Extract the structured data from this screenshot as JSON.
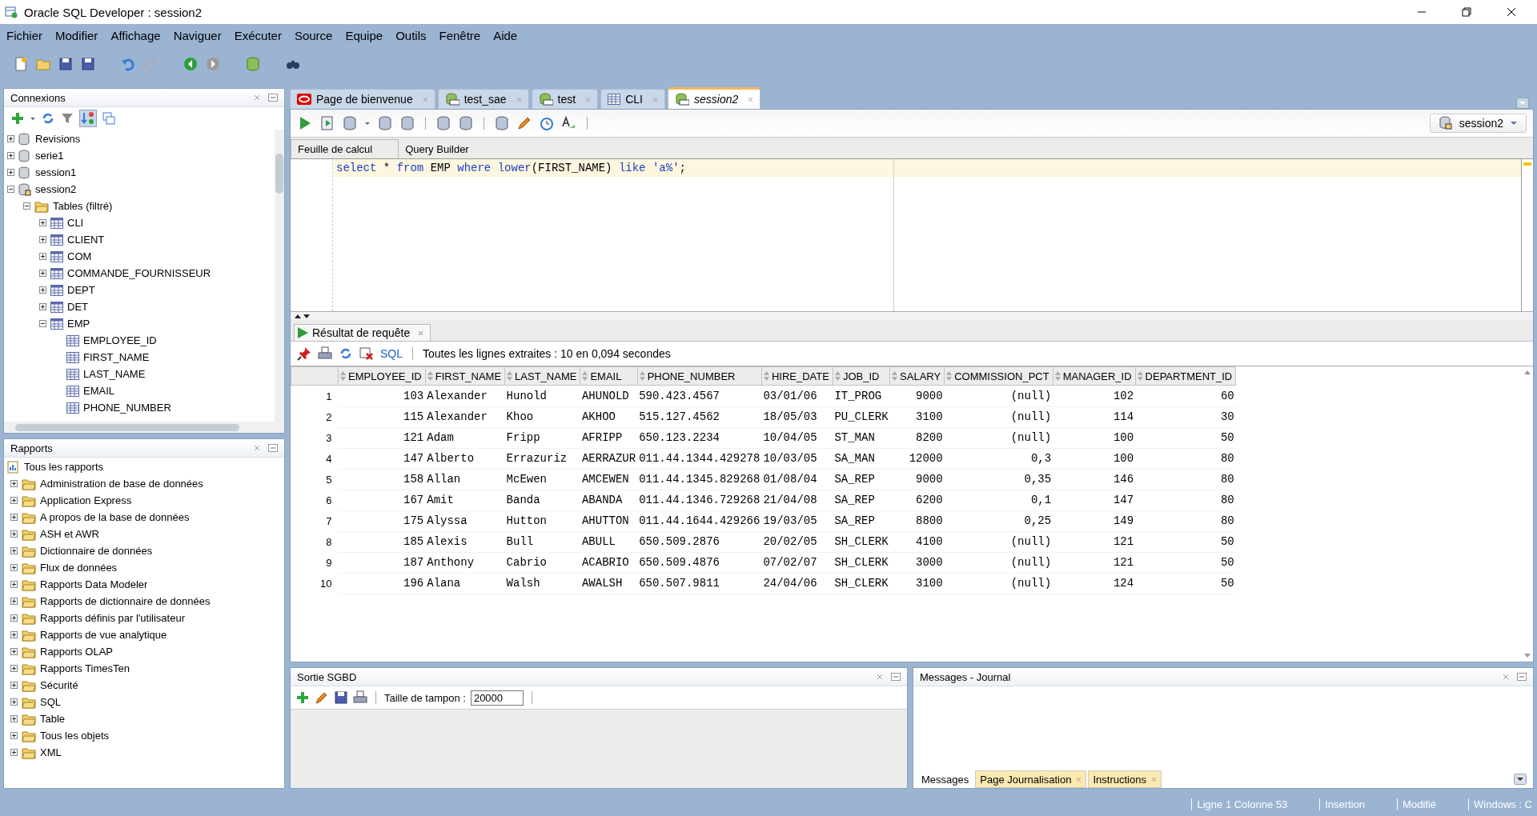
{
  "window": {
    "title": "Oracle SQL Developer : session2"
  },
  "menu": [
    "Fichier",
    "Modifier",
    "Affichage",
    "Naviguer",
    "Exécuter",
    "Source",
    "Equipe",
    "Outils",
    "Fenêtre",
    "Aide"
  ],
  "connections": {
    "title": "Connexions",
    "items": [
      {
        "label": "Revisions",
        "kind": "db",
        "expanded": false
      },
      {
        "label": "serie1",
        "kind": "db",
        "expanded": false
      },
      {
        "label": "session1",
        "kind": "db",
        "expanded": false
      },
      {
        "label": "session2",
        "kind": "dbopen",
        "expanded": true,
        "children": [
          {
            "label": "Tables (filtré)",
            "kind": "folder",
            "expanded": true,
            "children": [
              {
                "label": "CLI",
                "kind": "table",
                "expanded": false
              },
              {
                "label": "CLIENT",
                "kind": "table",
                "expanded": false
              },
              {
                "label": "COM",
                "kind": "table",
                "expanded": false
              },
              {
                "label": "COMMANDE_FOURNISSEUR",
                "kind": "table",
                "expanded": false
              },
              {
                "label": "DEPT",
                "kind": "table",
                "expanded": false
              },
              {
                "label": "DET",
                "kind": "table",
                "expanded": false
              },
              {
                "label": "EMP",
                "kind": "table",
                "expanded": true,
                "children": [
                  {
                    "label": "EMPLOYEE_ID",
                    "kind": "column"
                  },
                  {
                    "label": "FIRST_NAME",
                    "kind": "column"
                  },
                  {
                    "label": "LAST_NAME",
                    "kind": "column"
                  },
                  {
                    "label": "EMAIL",
                    "kind": "column"
                  },
                  {
                    "label": "PHONE_NUMBER",
                    "kind": "column"
                  }
                ]
              }
            ]
          }
        ]
      }
    ]
  },
  "reports": {
    "title": "Rapports",
    "items": [
      {
        "label": "Tous les rapports",
        "kind": "reports",
        "children": [
          {
            "label": "Administration de base de données",
            "kind": "folder",
            "expanded": false
          },
          {
            "label": "Application Express",
            "kind": "folder",
            "expanded": false
          },
          {
            "label": "A propos de la base de données",
            "kind": "folder",
            "expanded": false
          },
          {
            "label": "ASH et AWR",
            "kind": "folder",
            "expanded": false
          },
          {
            "label": "Dictionnaire de données",
            "kind": "folder",
            "expanded": false
          },
          {
            "label": "Flux de données",
            "kind": "folder",
            "expanded": false
          },
          {
            "label": "Rapports Data Modeler",
            "kind": "folder",
            "expanded": false
          },
          {
            "label": "Rapports de dictionnaire de données",
            "kind": "folder",
            "expanded": false
          },
          {
            "label": "Rapports définis par l'utilisateur",
            "kind": "folder",
            "expanded": false
          },
          {
            "label": "Rapports de vue analytique",
            "kind": "folder",
            "expanded": false
          },
          {
            "label": "Rapports OLAP",
            "kind": "folder",
            "expanded": false
          },
          {
            "label": "Rapports TimesTen",
            "kind": "folder",
            "expanded": false
          },
          {
            "label": "Sécurité",
            "kind": "folder",
            "expanded": false
          },
          {
            "label": "SQL",
            "kind": "folder",
            "expanded": false
          },
          {
            "label": "Table",
            "kind": "folder",
            "expanded": false
          },
          {
            "label": "Tous les objets",
            "kind": "folder",
            "expanded": false
          },
          {
            "label": "XML",
            "kind": "folder",
            "expanded": false
          }
        ]
      }
    ]
  },
  "editor_tabs": [
    {
      "label": "Page de bienvenue",
      "kind": "welcome",
      "selected": false
    },
    {
      "label": "test_sae",
      "kind": "sql",
      "selected": false
    },
    {
      "label": "test",
      "kind": "sql",
      "selected": false
    },
    {
      "label": "CLI",
      "kind": "table",
      "selected": false
    },
    {
      "label": "session2",
      "kind": "sql",
      "selected": true
    }
  ],
  "connection_selector": "session2",
  "worksheet_tabs": [
    {
      "label": "Feuille de calcul",
      "selected": true
    },
    {
      "label": "Query Builder",
      "selected": false
    }
  ],
  "sql": [
    {
      "text": "select ",
      "kind": "keyword"
    },
    {
      "text": "* ",
      "kind": "plain"
    },
    {
      "text": "from ",
      "kind": "keyword"
    },
    {
      "text": "EMP ",
      "kind": "plain"
    },
    {
      "text": "where ",
      "kind": "keyword"
    },
    {
      "text": "lower",
      "kind": "keyword"
    },
    {
      "text": "(FIRST_NAME) ",
      "kind": "plain"
    },
    {
      "text": "like ",
      "kind": "keyword"
    },
    {
      "text": "'a%'",
      "kind": "string"
    },
    {
      "text": ";",
      "kind": "plain"
    }
  ],
  "result": {
    "tab": "Résultat de requête",
    "sql_label": "SQL",
    "status": "Toutes les lignes extraites : 10 en 0,094 secondes",
    "columns": [
      {
        "name": "EMPLOYEE_ID",
        "numeric": true
      },
      {
        "name": "FIRST_NAME",
        "numeric": false
      },
      {
        "name": "LAST_NAME",
        "numeric": false
      },
      {
        "name": "EMAIL",
        "numeric": false
      },
      {
        "name": "PHONE_NUMBER",
        "numeric": false
      },
      {
        "name": "HIRE_DATE",
        "numeric": false
      },
      {
        "name": "JOB_ID",
        "numeric": false
      },
      {
        "name": "SALARY",
        "numeric": true
      },
      {
        "name": "COMMISSION_PCT",
        "numeric": true
      },
      {
        "name": "MANAGER_ID",
        "numeric": true
      },
      {
        "name": "DEPARTMENT_ID",
        "numeric": true
      }
    ],
    "rows": [
      {
        "num": "1",
        "cells": [
          "103",
          "Alexander",
          "Hunold",
          "AHUNOLD",
          "590.423.4567",
          "03/01/06",
          "IT_PROG",
          "9000",
          "(null)",
          "102",
          "60"
        ]
      },
      {
        "num": "2",
        "cells": [
          "115",
          "Alexander",
          "Khoo",
          "AKHOO",
          "515.127.4562",
          "18/05/03",
          "PU_CLERK",
          "3100",
          "(null)",
          "114",
          "30"
        ]
      },
      {
        "num": "3",
        "cells": [
          "121",
          "Adam",
          "Fripp",
          "AFRIPP",
          "650.123.2234",
          "10/04/05",
          "ST_MAN",
          "8200",
          "(null)",
          "100",
          "50"
        ]
      },
      {
        "num": "4",
        "cells": [
          "147",
          "Alberto",
          "Errazuriz",
          "AERRAZUR",
          "011.44.1344.429278",
          "10/03/05",
          "SA_MAN",
          "12000",
          "0,3",
          "100",
          "80"
        ]
      },
      {
        "num": "5",
        "cells": [
          "158",
          "Allan",
          "McEwen",
          "AMCEWEN",
          "011.44.1345.829268",
          "01/08/04",
          "SA_REP",
          "9000",
          "0,35",
          "146",
          "80"
        ]
      },
      {
        "num": "6",
        "cells": [
          "167",
          "Amit",
          "Banda",
          "ABANDA",
          "011.44.1346.729268",
          "21/04/08",
          "SA_REP",
          "6200",
          "0,1",
          "147",
          "80"
        ]
      },
      {
        "num": "7",
        "cells": [
          "175",
          "Alyssa",
          "Hutton",
          "AHUTTON",
          "011.44.1644.429266",
          "19/03/05",
          "SA_REP",
          "8800",
          "0,25",
          "149",
          "80"
        ]
      },
      {
        "num": "8",
        "cells": [
          "185",
          "Alexis",
          "Bull",
          "ABULL",
          "650.509.2876",
          "20/02/05",
          "SH_CLERK",
          "4100",
          "(null)",
          "121",
          "50"
        ]
      },
      {
        "num": "9",
        "cells": [
          "187",
          "Anthony",
          "Cabrio",
          "ACABRIO",
          "650.509.4876",
          "07/02/07",
          "SH_CLERK",
          "3000",
          "(null)",
          "121",
          "50"
        ]
      },
      {
        "num": "10",
        "cells": [
          "196",
          "Alana",
          "Walsh",
          "AWALSH",
          "650.507.9811",
          "24/04/06",
          "SH_CLERK",
          "3100",
          "(null)",
          "124",
          "50"
        ]
      }
    ]
  },
  "dbms_output": {
    "title": "Sortie SGBD",
    "buffer_label": "Taille de tampon :",
    "buffer_value": "20000"
  },
  "messages": {
    "title": "Messages - Journal",
    "tabs": [
      {
        "label": "Messages",
        "selected": true
      },
      {
        "label": "Page Journalisation",
        "selected": false
      },
      {
        "label": "Instructions",
        "selected": false
      }
    ]
  },
  "status_bar": [
    "Ligne 1 Colonne 53",
    "Insertion",
    "Modifié",
    "Windows : C"
  ]
}
